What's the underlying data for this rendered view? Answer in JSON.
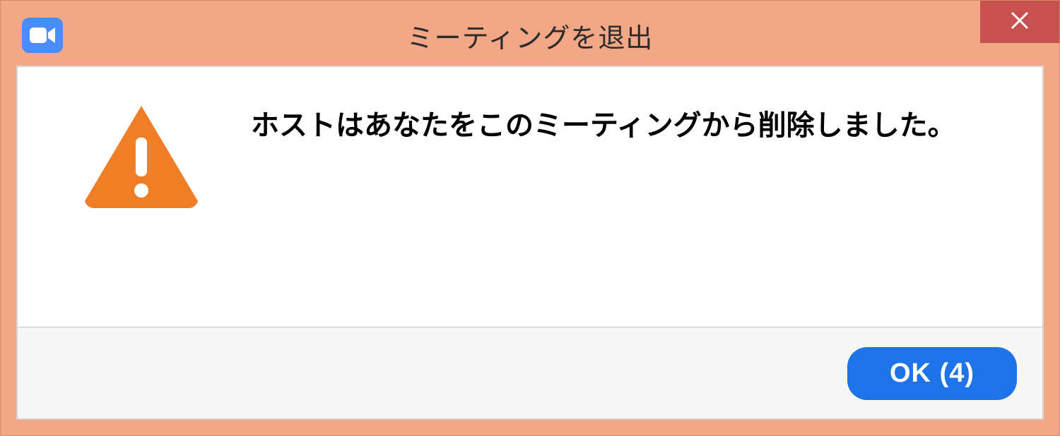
{
  "titlebar": {
    "title": "ミーティングを退出",
    "app_icon": "video-camera-icon",
    "close_label": "×"
  },
  "body": {
    "warning_icon": "warning-triangle-icon",
    "message": "ホストはあなたをこのミーティングから削除しました。"
  },
  "footer": {
    "ok_label": "OK (4)"
  }
}
